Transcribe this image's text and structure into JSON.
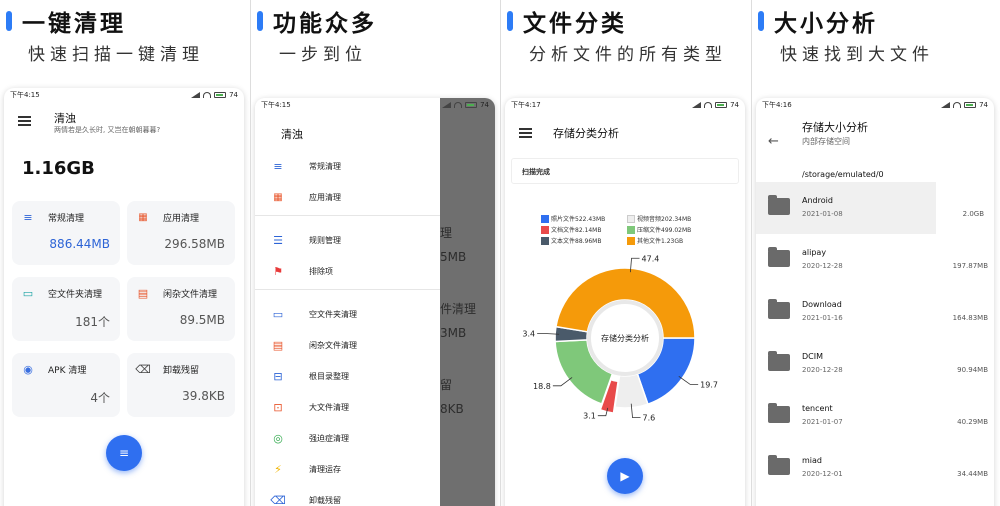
{
  "panels": [
    {
      "title": "一键清理",
      "subtitle": "快速扫描一键清理"
    },
    {
      "title": "功能众多",
      "subtitle": "一步到位"
    },
    {
      "title": "文件分类",
      "subtitle": "分析文件的所有类型"
    },
    {
      "title": "大小分析",
      "subtitle": "快速找到大文件"
    }
  ],
  "colors": {
    "accent": "#2f6ff0",
    "header_bar": "#2d7cf6"
  },
  "screen1": {
    "time": "下午4:15",
    "battery": "74",
    "app_title": "清浊",
    "app_subtitle": "两情若是久长时, 又岂在朝朝暮暮?",
    "total": "1.16GB",
    "cards": [
      {
        "icon": "list-icon",
        "label": "常规清理",
        "value": "886.44MB"
      },
      {
        "icon": "apps-icon",
        "label": "应用清理",
        "value": "296.58MB"
      },
      {
        "icon": "folder-icon",
        "label": "空文件夹清理",
        "value": "181个"
      },
      {
        "icon": "document-icon",
        "label": "闲杂文件清理",
        "value": "89.5MB"
      },
      {
        "icon": "android-icon",
        "label": "APK 清理",
        "value": "4个"
      },
      {
        "icon": "uninstall-icon",
        "label": "卸载残留",
        "value": "39.8KB"
      }
    ]
  },
  "screen2": {
    "time": "下午4:15",
    "battery": "74",
    "drawer_title": "清浊",
    "items": [
      "常规清理",
      "应用清理",
      "规则管理",
      "排除项",
      "空文件夹清理",
      "闲杂文件清理",
      "根目录整理",
      "大文件清理",
      "强迫症清理",
      "清理运存",
      "卸载残留"
    ],
    "background_fragments": [
      "理",
      "5MB",
      "件清理",
      "3MB",
      "留",
      "8KB"
    ]
  },
  "screen3": {
    "time": "下午4:17",
    "battery": "74",
    "app_title": "存储分类分析",
    "scan_status": "扫描完成",
    "center_label": "存储分类分析"
  },
  "chart_data": {
    "type": "pie",
    "title": "存储分类分析",
    "series": [
      {
        "name": "照片文件",
        "size": "522.43MB",
        "value": 19.7,
        "color": "#2f6ff0"
      },
      {
        "name": "视频音频",
        "size": "202.34MB",
        "value": 7.6,
        "color": "#eeeeee"
      },
      {
        "name": "文档文件",
        "size": "82.14MB",
        "value": 3.1,
        "color": "#e84a4a"
      },
      {
        "name": "压缩文件",
        "size": "499.02MB",
        "value": 18.8,
        "color": "#7fc87a"
      },
      {
        "name": "文本文件",
        "size": "88.96MB",
        "value": 3.4,
        "color": "#4a5a6a"
      },
      {
        "name": "其他文件",
        "size": "1.23GB",
        "value": 47.4,
        "color": "#f59a0a"
      }
    ],
    "legend_position": "top"
  },
  "screen4": {
    "time": "下午4:16",
    "battery": "74",
    "app_title": "存储大小分析",
    "app_subtitle": "内部存储空间",
    "path": "/storage/emulated/0",
    "files": [
      {
        "name": "Android",
        "date": "2021-01-08",
        "size": "2.0GB"
      },
      {
        "name": "alipay",
        "date": "2020-12-28",
        "size": "197.87MB"
      },
      {
        "name": "Download",
        "date": "2021-01-16",
        "size": "164.83MB"
      },
      {
        "name": "DCIM",
        "date": "2020-12-28",
        "size": "90.94MB"
      },
      {
        "name": "tencent",
        "date": "2021-01-07",
        "size": "40.29MB"
      },
      {
        "name": "miad",
        "date": "2020-12-01",
        "size": "34.44MB"
      }
    ]
  }
}
